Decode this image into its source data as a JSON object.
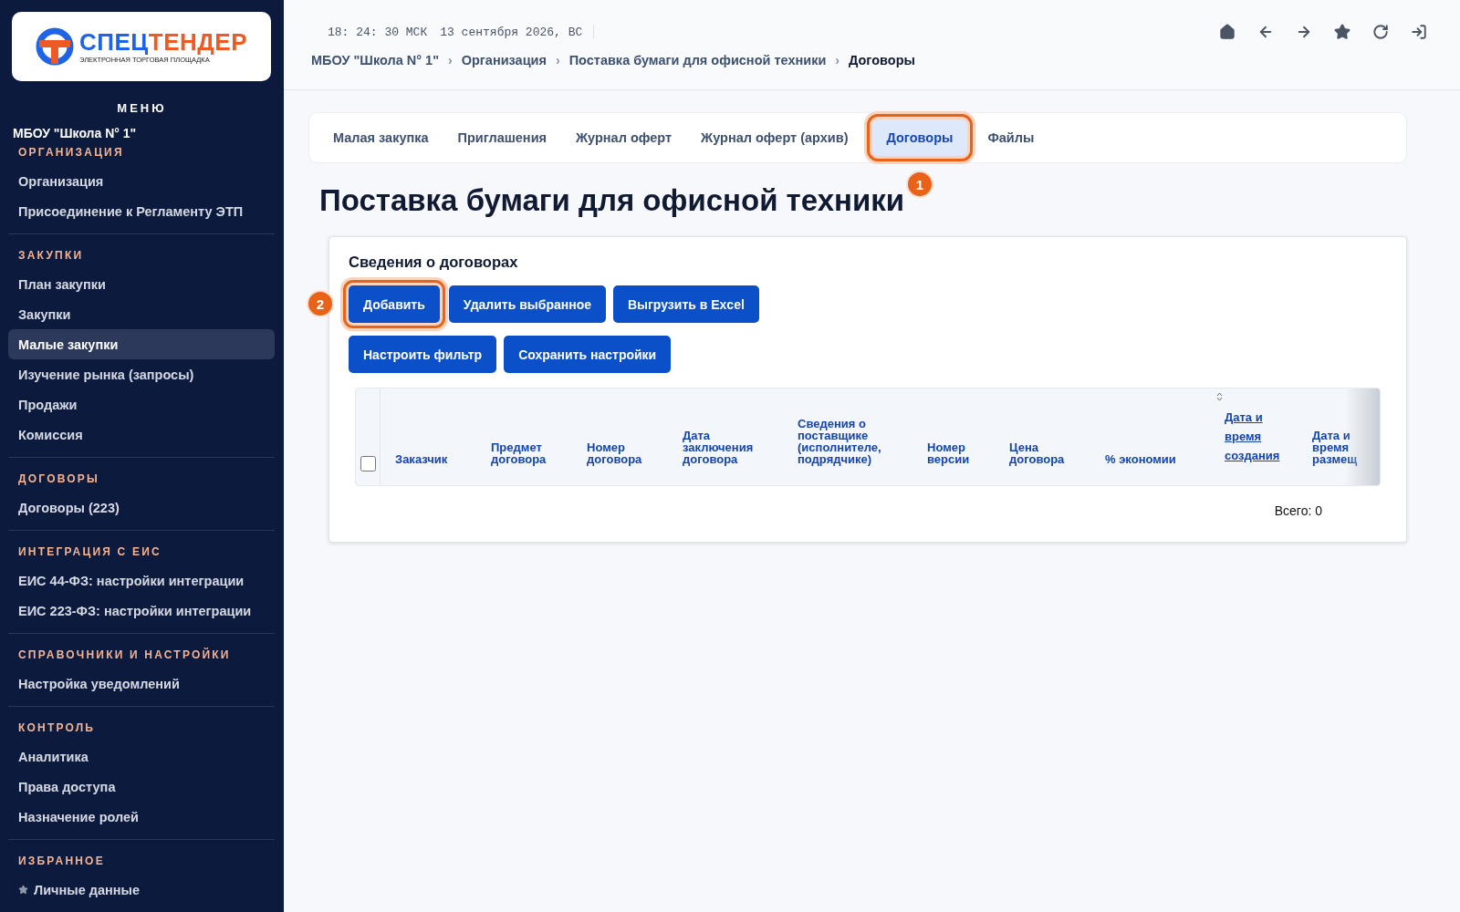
{
  "logo": {
    "part_1": "СПЕЦ",
    "part_2": "ТЕНДЕР",
    "tagline": "ЭЛЕКТРОННАЯ ТОРГОВАЯ ПЛОЩАДКА"
  },
  "sidebar": {
    "menu_title": "МЕНЮ",
    "org_name": "МБОУ \"Школа N° 1\"",
    "sections": [
      {
        "title": "ОРГАНИЗАЦИЯ",
        "items": [
          {
            "label": "Организация",
            "selected": false
          },
          {
            "label": "Присоединение к Регламенту ЭТП",
            "selected": false
          }
        ]
      },
      {
        "title": "ЗАКУПКИ",
        "items": [
          {
            "label": "План закупки",
            "selected": false
          },
          {
            "label": "Закупки",
            "selected": false
          },
          {
            "label": "Малые закупки",
            "selected": true
          },
          {
            "label": "Изучение рынка (запросы)",
            "selected": false
          },
          {
            "label": "Продажи",
            "selected": false
          },
          {
            "label": "Комиссия",
            "selected": false
          }
        ]
      },
      {
        "title": "ДОГОВОРЫ",
        "items": [
          {
            "label": "Договоры (223)",
            "selected": false
          }
        ]
      },
      {
        "title": "ИНТЕГРАЦИЯ С ЕИС",
        "items": [
          {
            "label": "ЕИС 44-ФЗ: настройки интеграции",
            "selected": false
          },
          {
            "label": "ЕИС 223-ФЗ: настройки интеграции",
            "selected": false
          }
        ]
      },
      {
        "title": "СПРАВОЧНИКИ И НАСТРОЙКИ",
        "items": [
          {
            "label": "Настройка уведомлений",
            "selected": false
          }
        ]
      },
      {
        "title": "КОНТРОЛЬ",
        "items": [
          {
            "label": "Аналитика",
            "selected": false
          },
          {
            "label": "Права доступа",
            "selected": false
          },
          {
            "label": "Назначение ролей",
            "selected": false
          }
        ]
      },
      {
        "title": "ИЗБРАННОЕ",
        "items": [
          {
            "label": "Личные данные",
            "selected": false,
            "starred": true
          }
        ]
      }
    ]
  },
  "header": {
    "clock": "18: 24: 30 МСК",
    "date": "13 сентября 2026, ВС",
    "breadcrumbs": [
      "МБОУ \"Школа N° 1\"",
      "Организация",
      "Поставка бумаги для офисной техники",
      "Договоры"
    ],
    "separator": "›"
  },
  "tabs": [
    {
      "label": "Малая закупка",
      "selected": false,
      "highlighted": false
    },
    {
      "label": "Приглашения",
      "selected": false,
      "highlighted": false
    },
    {
      "label": "Журнал оферт",
      "selected": false,
      "highlighted": false
    },
    {
      "label": "Журнал оферт (архив)",
      "selected": false,
      "highlighted": false
    },
    {
      "label": "Договоры",
      "selected": true,
      "highlighted": true,
      "callout": "1"
    },
    {
      "label": "Файлы",
      "selected": false,
      "highlighted": false
    }
  ],
  "page_title": "Поставка бумаги для офисной техники",
  "panel": {
    "title": "Сведения о договорах",
    "button_rows": [
      [
        {
          "label": "Добавить",
          "highlighted": true,
          "callout": "2"
        },
        {
          "label": "Удалить выбранное",
          "highlighted": false
        },
        {
          "label": "Выгрузить в Excel",
          "highlighted": false
        }
      ],
      [
        {
          "label": "Настроить фильтр",
          "highlighted": false
        },
        {
          "label": "Сохранить настройки",
          "highlighted": false
        }
      ]
    ],
    "table": {
      "select_all_checked": false,
      "columns": [
        {
          "label": "Заказчик",
          "kind": "plain"
        },
        {
          "label": "Предмет договора",
          "kind": "plain"
        },
        {
          "label": "Номер договора",
          "kind": "plain"
        },
        {
          "label": "Дата заключения договора",
          "kind": "plain"
        },
        {
          "label": "Сведения о поставщике (исполнителе, подрядчике)",
          "kind": "plain"
        },
        {
          "label": "Номер версии",
          "kind": "plain"
        },
        {
          "label": "Цена договора",
          "kind": "plain"
        },
        {
          "label": "% экономии",
          "kind": "plain"
        },
        {
          "label": "Дата и время создания",
          "kind": "sortable"
        },
        {
          "label": "Дата и время размещ",
          "kind": "plain"
        }
      ]
    },
    "total": "Всего: 0"
  }
}
